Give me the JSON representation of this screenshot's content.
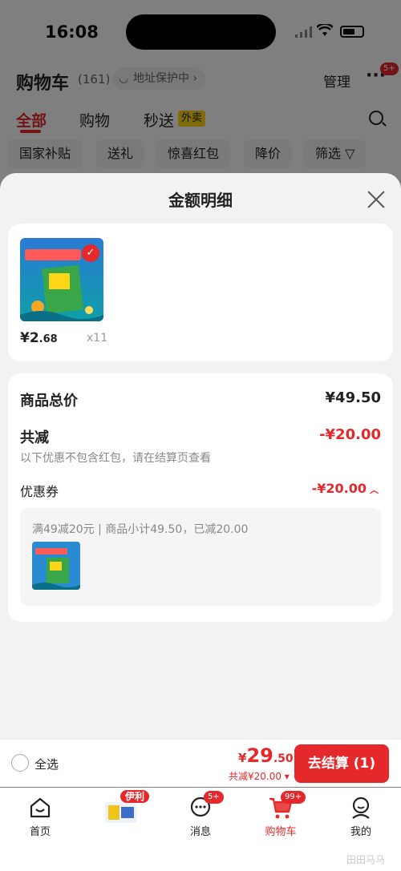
{
  "status_bar": {
    "time": "16:08"
  },
  "background": {
    "title": "购物车",
    "count": "(161)",
    "address_tag": "地址保护中 ›",
    "manage": "管理",
    "more_badge": "5+",
    "tabs": [
      "全部",
      "购物",
      "秒送"
    ],
    "takeout_tag": "外卖",
    "chips": [
      "国家补贴",
      "送礼",
      "惊喜红包",
      "降价",
      "筛选 ▽"
    ]
  },
  "sheet": {
    "title": "金额明细",
    "product": {
      "price_int": "¥2",
      "price_dec": ".68",
      "quantity": "x11"
    },
    "summary": {
      "total_label": "商品总价",
      "total_value": "¥49.50",
      "discount_label": "共减",
      "discount_value": "-¥20.00",
      "note": "以下优惠不包含红包，请在结算页查看",
      "coupon_label": "优惠券",
      "coupon_value": "-¥20.00",
      "coupon_desc": "满49减20元 | 商品小计49.50，已减20.00"
    }
  },
  "checkout": {
    "select_all": "全选",
    "yen": "¥",
    "total_int": "29",
    "total_dec": ".50",
    "reduce_text": "共减¥20.00 ▾",
    "button": "去结算 (1)"
  },
  "nav": {
    "home": "首页",
    "brand_tag": "伊利",
    "messages": "消息",
    "messages_badge": "5+",
    "cart": "购物车",
    "cart_badge": "99+",
    "me": "我的"
  },
  "watermark": "田田马马",
  "colors": {
    "accent": "#e5282a",
    "takeout": "#ffd617"
  }
}
